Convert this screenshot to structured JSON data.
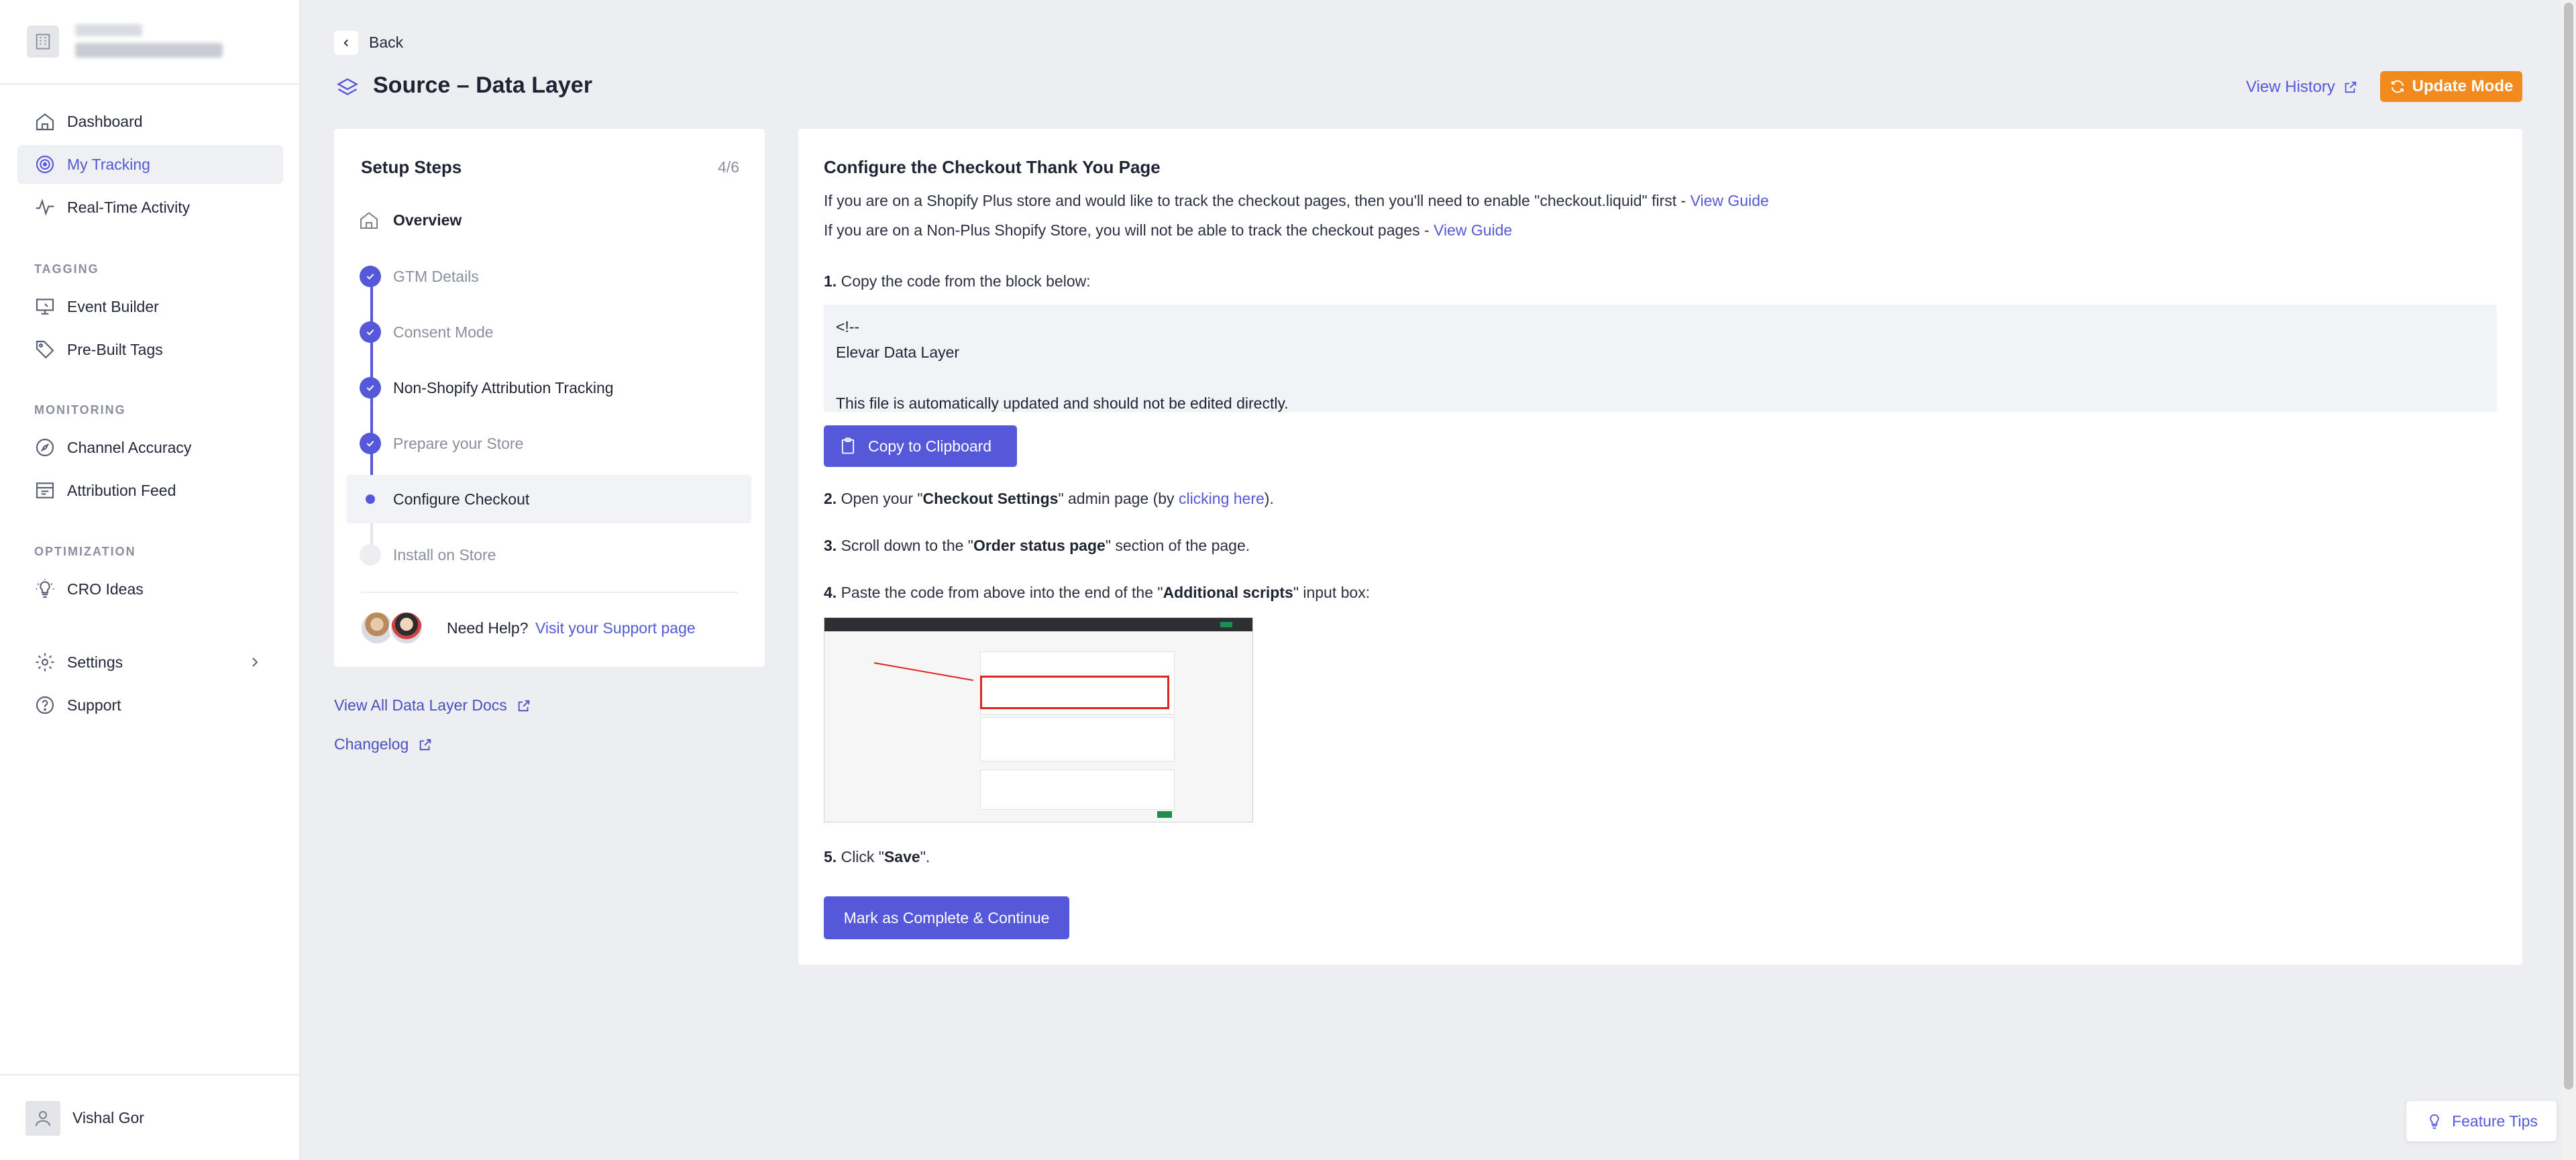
{
  "sidebar": {
    "nav": [
      {
        "label": "Dashboard",
        "icon": "home-icon"
      },
      {
        "label": "My Tracking",
        "icon": "tracking-icon",
        "active": true
      },
      {
        "label": "Real-Time Activity",
        "icon": "activity-icon"
      }
    ],
    "sections": {
      "tagging": "TAGGING",
      "monitoring": "MONITORING",
      "optimization": "OPTIMIZATION"
    },
    "tagging_items": [
      {
        "label": "Event Builder",
        "icon": "monitor-icon"
      },
      {
        "label": "Pre-Built Tags",
        "icon": "tag-icon"
      }
    ],
    "monitoring_items": [
      {
        "label": "Channel Accuracy",
        "icon": "compass-icon"
      },
      {
        "label": "Attribution Feed",
        "icon": "feed-icon"
      }
    ],
    "optimization_items": [
      {
        "label": "CRO Ideas",
        "icon": "lightbulb-icon"
      }
    ],
    "settings_label": "Settings",
    "support_label": "Support",
    "user_name": "Vishal Gor"
  },
  "header": {
    "back_label": "Back",
    "title": "Source – Data Layer",
    "view_history": "View History",
    "update_mode": "Update Mode"
  },
  "setup": {
    "title": "Setup Steps",
    "count": "4/6",
    "steps": [
      {
        "label": "Overview",
        "state": "overview"
      },
      {
        "label": "GTM Details",
        "state": "done"
      },
      {
        "label": "Consent Mode",
        "state": "done"
      },
      {
        "label": "Non-Shopify Attribution Tracking",
        "state": "done"
      },
      {
        "label": "Prepare your Store",
        "state": "done"
      },
      {
        "label": "Configure Checkout",
        "state": "current"
      },
      {
        "label": "Install on Store",
        "state": "todo"
      }
    ],
    "help_text": "Need Help?",
    "help_link": "Visit your Support page"
  },
  "links": {
    "docs": "View All Data Layer Docs",
    "changelog": "Changelog"
  },
  "content": {
    "title": "Configure the Checkout Thank You Page",
    "plus_text": "If you are on a Shopify Plus store and would like to track the checkout pages, then you'll need to enable \"checkout.liquid\" first - ",
    "nonplus_text": "If you are on a Non-Plus Shopify Store, you will not be able to track the checkout pages - ",
    "view_guide": "View Guide",
    "step1_num": "1.",
    "step1_text": "Copy the code from the block below:",
    "code_lines": [
      "<!--",
      "Elevar Data Layer",
      "",
      "This file is automatically updated and should not be edited directly."
    ],
    "copy_button": "Copy to Clipboard",
    "step2_num": "2.",
    "step2_a": "Open your \"",
    "step2_b": "Checkout Settings",
    "step2_c": "\" admin page (by ",
    "step2_link": "clicking here",
    "step2_d": ").",
    "step3_num": "3.",
    "step3_a": "Scroll down to the \"",
    "step3_b": "Order status page",
    "step3_c": "\" section of the page.",
    "step4_num": "4.",
    "step4_a": "Paste the code from above into the end of the \"",
    "step4_b": "Additional scripts",
    "step4_c": "\" input box:",
    "step5_num": "5.",
    "step5_a": "Click \"",
    "step5_b": "Save",
    "step5_c": "\".",
    "complete_button": "Mark as Complete & Continue"
  },
  "feature_tips": "Feature Tips",
  "colors": {
    "accent": "#5558d9",
    "update_mode": "#f28a1e",
    "background": "#eceef1"
  }
}
